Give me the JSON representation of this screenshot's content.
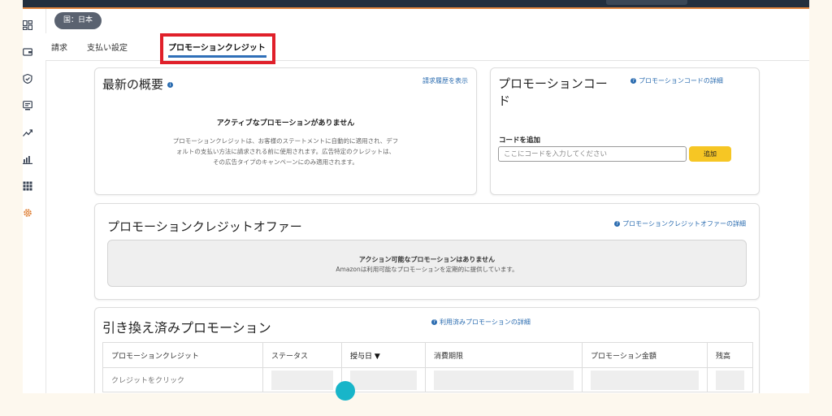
{
  "header": {
    "country_label": "国：日本"
  },
  "tabs": [
    {
      "label": "請求",
      "active": false
    },
    {
      "label": "支払い設定",
      "active": false
    },
    {
      "label": "プロモーションクレジット",
      "active": true
    }
  ],
  "sidebar": {
    "icons": [
      "dashboard-icon",
      "wallet-icon",
      "shield-icon",
      "monitor-icon",
      "trend-icon",
      "bar-chart-icon",
      "grid-icon",
      "settings-icon"
    ]
  },
  "latest_overview": {
    "title": "最新の概要",
    "link": "請求履歴を表示",
    "empty_title": "アクティブなプロモーションがありません",
    "empty_lines": [
      "プロモーションクレジットは、お客様のステートメントに自動的に適用され、デフ",
      "ォルトの支払い方法に請求される前に使用されます。広告特定のクレジットは、",
      "その広告タイプのキャンペーンにのみ適用されます。"
    ]
  },
  "promo_code": {
    "title_line1": "プロモーションコー",
    "title_line2": "ド",
    "link": "プロモーションコードの詳細",
    "add_label": "コードを追加",
    "input_placeholder": "ここにコードを入力してください",
    "add_button": "追加"
  },
  "offers": {
    "title": "プロモーションクレジットオファー",
    "link": "プロモーションクレジットオファーの詳細",
    "empty_title": "アクション可能なプロモーションはありません",
    "empty_sub": "Amazonは利用可能なプロモーションを定期的に提供しています。"
  },
  "redeemed": {
    "title": "引き換え済みプロモーション",
    "link": "利用済みプロモーションの詳細",
    "columns": [
      "プロモーションクレジット",
      "ステータス",
      "授与日 ▼",
      "消費期限",
      "プロモーション金額",
      "残高"
    ],
    "first_row_label": "クレジットをクリック"
  },
  "colors": {
    "accent_blue": "#2b6cb0",
    "highlight_red": "#e0202a",
    "button_yellow": "#f6c624",
    "cursor_teal": "#18b5c9",
    "topbar_dark": "#232f3e"
  }
}
